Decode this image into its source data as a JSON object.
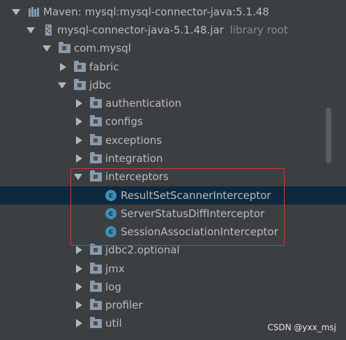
{
  "tree": [
    {
      "label": "Maven: mysql:mysql-connector-java:5.1.48",
      "expanded": true,
      "icon": "library-icon"
    },
    {
      "label": "mysql-connector-java-5.1.48.jar",
      "suffix": "library root",
      "expanded": true,
      "icon": "jar-icon"
    },
    {
      "label": "com.mysql",
      "expanded": true,
      "icon": "package-folder-icon"
    },
    {
      "label": "fabric",
      "expanded": false,
      "icon": "package-folder-icon"
    },
    {
      "label": "jdbc",
      "expanded": true,
      "icon": "package-folder-icon"
    },
    {
      "label": "authentication",
      "expanded": false,
      "icon": "package-folder-icon"
    },
    {
      "label": "configs",
      "expanded": false,
      "icon": "package-folder-icon"
    },
    {
      "label": "exceptions",
      "expanded": false,
      "icon": "package-folder-icon"
    },
    {
      "label": "integration",
      "expanded": false,
      "icon": "package-folder-icon"
    },
    {
      "label": "interceptors",
      "expanded": true,
      "icon": "package-folder-icon"
    },
    {
      "label": "ResultSetScannerInterceptor",
      "icon": "class-icon",
      "selected": true
    },
    {
      "label": "ServerStatusDiffInterceptor",
      "icon": "class-icon"
    },
    {
      "label": "SessionAssociationInterceptor",
      "icon": "class-icon"
    },
    {
      "label": "jdbc2.optional",
      "expanded": false,
      "icon": "package-folder-icon"
    },
    {
      "label": "jmx",
      "expanded": false,
      "icon": "package-folder-icon"
    },
    {
      "label": "log",
      "expanded": false,
      "icon": "package-folder-icon"
    },
    {
      "label": "profiler",
      "expanded": false,
      "icon": "package-folder-icon"
    },
    {
      "label": "util",
      "expanded": false,
      "icon": "package-folder-icon"
    }
  ],
  "class_icon_letter": "c",
  "watermark": "CSDN @yxx_msj",
  "colors": {
    "highlight_border": "#d13b3b",
    "selection": "#0d293e",
    "class_icon": "#3d8fb7"
  }
}
